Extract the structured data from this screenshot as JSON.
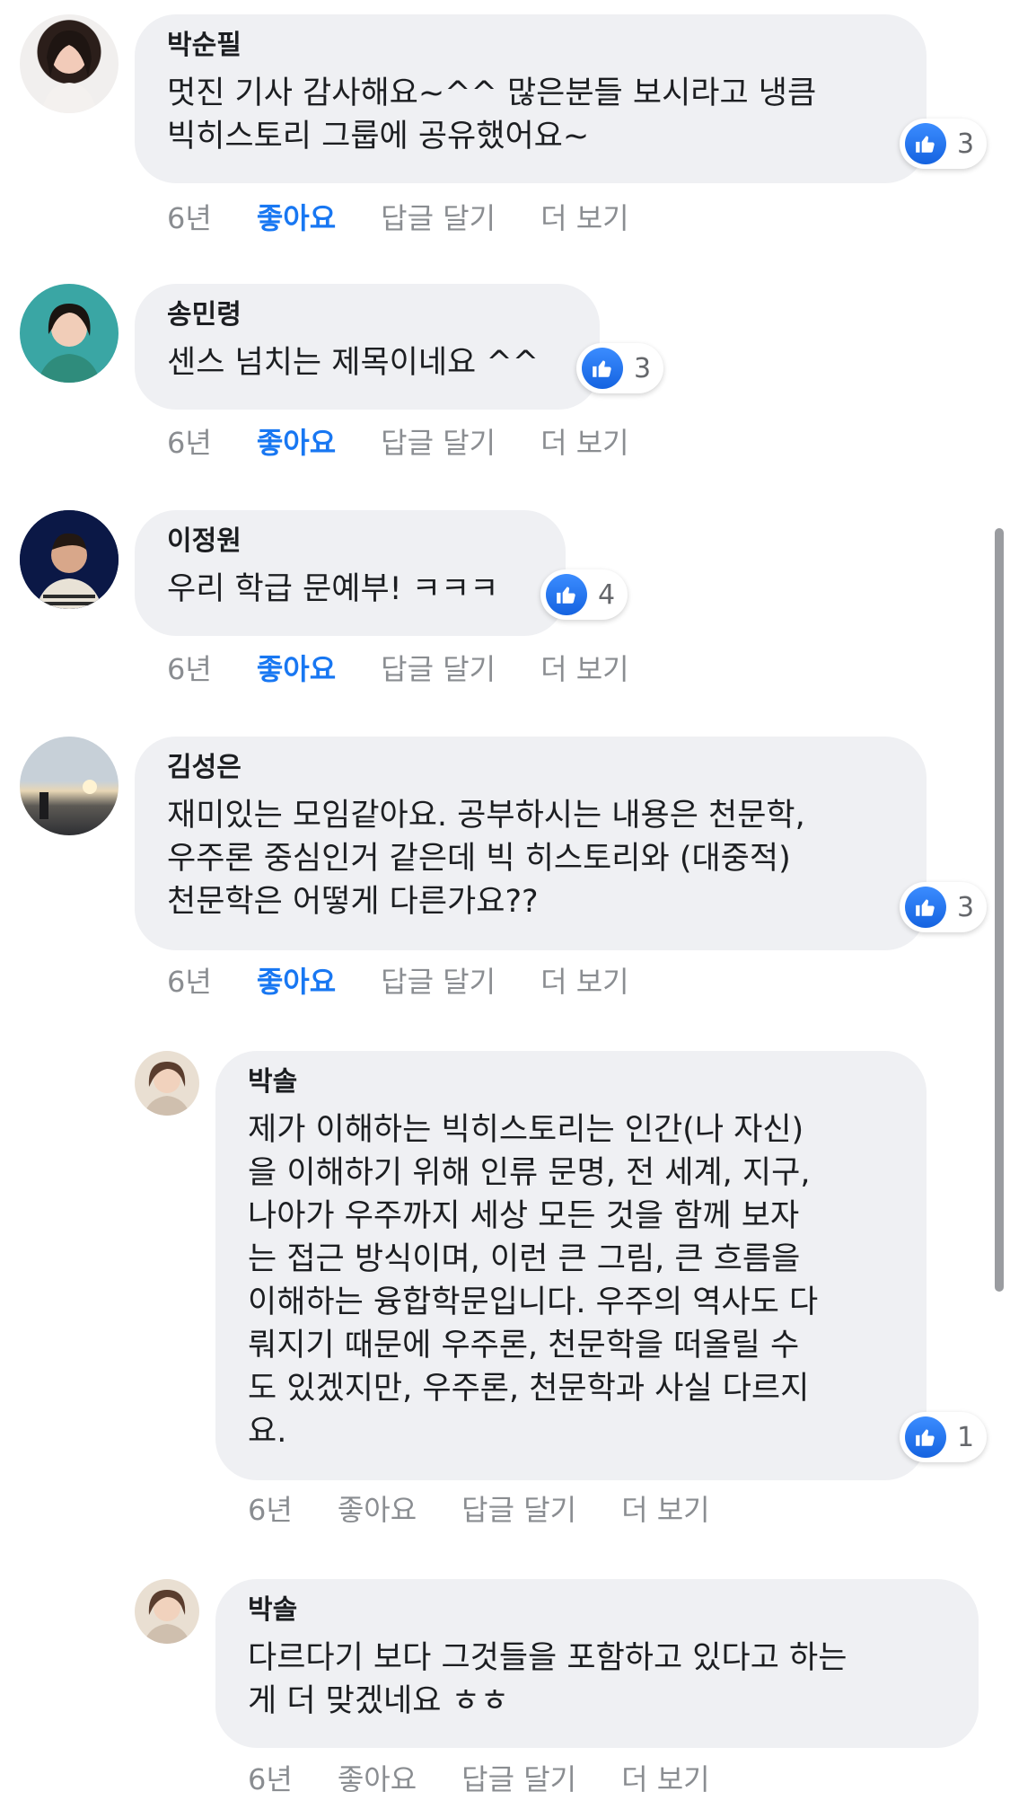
{
  "comments": [
    {
      "author": "박순필",
      "text": "멋진 기사 감사해요~^^ 많은분들 보시라고 냉큼\n빅히스토리 그룹에 공유했어요~",
      "reactions": "3",
      "time": "6년",
      "like": "좋아요",
      "reply": "답글 달기",
      "more": "더 보기",
      "liked": true
    },
    {
      "author": "송민령",
      "text": "센스 넘치는 제목이네요 ^^",
      "reactions": "3",
      "time": "6년",
      "like": "좋아요",
      "reply": "답글 달기",
      "more": "더 보기",
      "liked": true
    },
    {
      "author": "이정원",
      "text": "우리 학급 문예부! ㅋㅋㅋ",
      "reactions": "4",
      "time": "6년",
      "like": "좋아요",
      "reply": "답글 달기",
      "more": "더 보기",
      "liked": true
    },
    {
      "author": "김성은",
      "text": "재미있는 모임같아요. 공부하시는 내용은 천문학,\n우주론 중심인거 같은데 빅 히스토리와 (대중적)\n천문학은 어떻게 다른가요??",
      "reactions": "3",
      "time": "6년",
      "like": "좋아요",
      "reply": "답글 달기",
      "more": "더 보기",
      "liked": true
    },
    {
      "author": "박솔",
      "text": "제가 이해하는 빅히스토리는 인간(나 자신)\n을 이해하기 위해 인류 문명, 전 세계, 지구,\n나아가 우주까지 세상 모든 것을 함께 보자\n는 접근 방식이며, 이런 큰 그림, 큰 흐름을\n이해하는 융합학문입니다. 우주의 역사도 다\n뤄지기 때문에 우주론, 천문학을 떠올릴 수\n도 있겠지만, 우주론, 천문학과 사실 다르지\n요.",
      "reactions": "1",
      "time": "6년",
      "like": "좋아요",
      "reply": "답글 달기",
      "more": "더 보기",
      "liked": false
    },
    {
      "author": "박솔",
      "text": "다르다기 보다 그것들을 포함하고 있다고 하는\n게 더 맞겠네요 ㅎㅎ",
      "reactions": "",
      "time": "6년",
      "like": "좋아요",
      "reply": "답글 달기",
      "more": "더 보기",
      "liked": false
    }
  ],
  "colors": {
    "bubble": "#eff0f3",
    "liked": "#1877f2",
    "meta": "#8a8d91",
    "reaction": "#1877f2"
  },
  "icons": {
    "reaction": "thumbs-up-icon"
  }
}
